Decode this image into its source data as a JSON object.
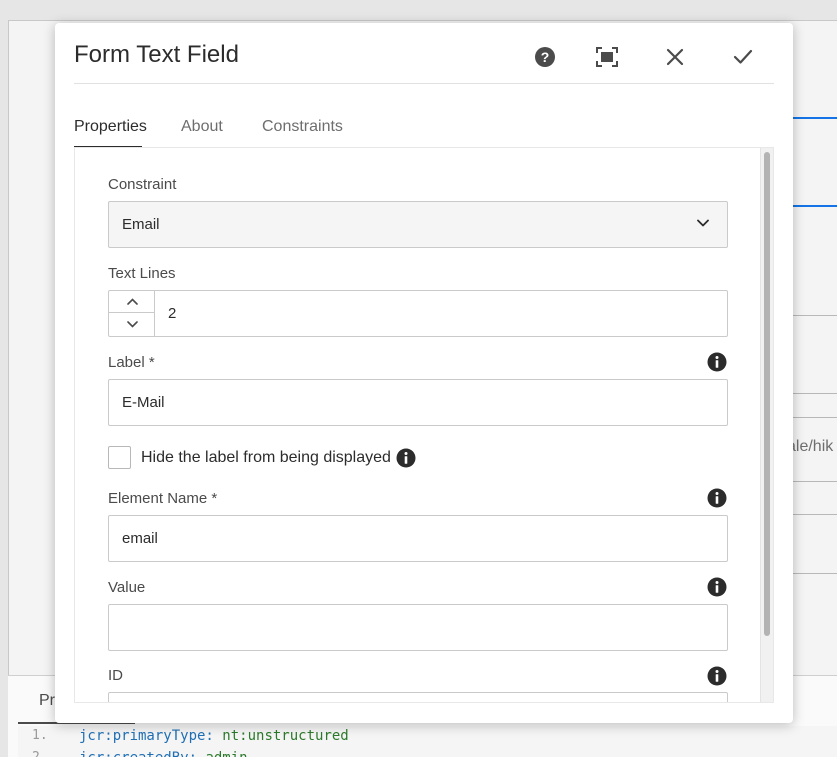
{
  "background": {
    "right_text": "ale/hik",
    "bottom_tab": "Pr",
    "code_lines": [
      {
        "num": "1.",
        "key": "jcr:primaryType:",
        "value": "nt:unstructured"
      },
      {
        "num": "2.",
        "key": "jcr:createdBy:",
        "value": "admin"
      }
    ]
  },
  "dialog": {
    "title": "Form Text Field",
    "buttons": {
      "help": "help-icon",
      "fullscreen": "fullscreen-icon",
      "close": "close-icon",
      "done": "checkmark-icon"
    },
    "tabs": [
      {
        "label": "Properties",
        "active": true
      },
      {
        "label": "About",
        "active": false
      },
      {
        "label": "Constraints",
        "active": false
      }
    ],
    "fields": {
      "constraint": {
        "label": "Constraint",
        "value": "Email"
      },
      "text_lines": {
        "label": "Text Lines",
        "value": "2"
      },
      "label": {
        "label": "Label *",
        "value": "E-Mail"
      },
      "hide_label": {
        "label": "Hide the label from being displayed",
        "checked": false
      },
      "element_name": {
        "label": "Element Name *",
        "value": "email"
      },
      "value": {
        "label": "Value",
        "value": ""
      },
      "id": {
        "label": "ID",
        "value": ""
      }
    }
  },
  "colors": {
    "accent": "#1473e6",
    "text": "#2c2c2c",
    "muted": "#6e6e6e"
  }
}
